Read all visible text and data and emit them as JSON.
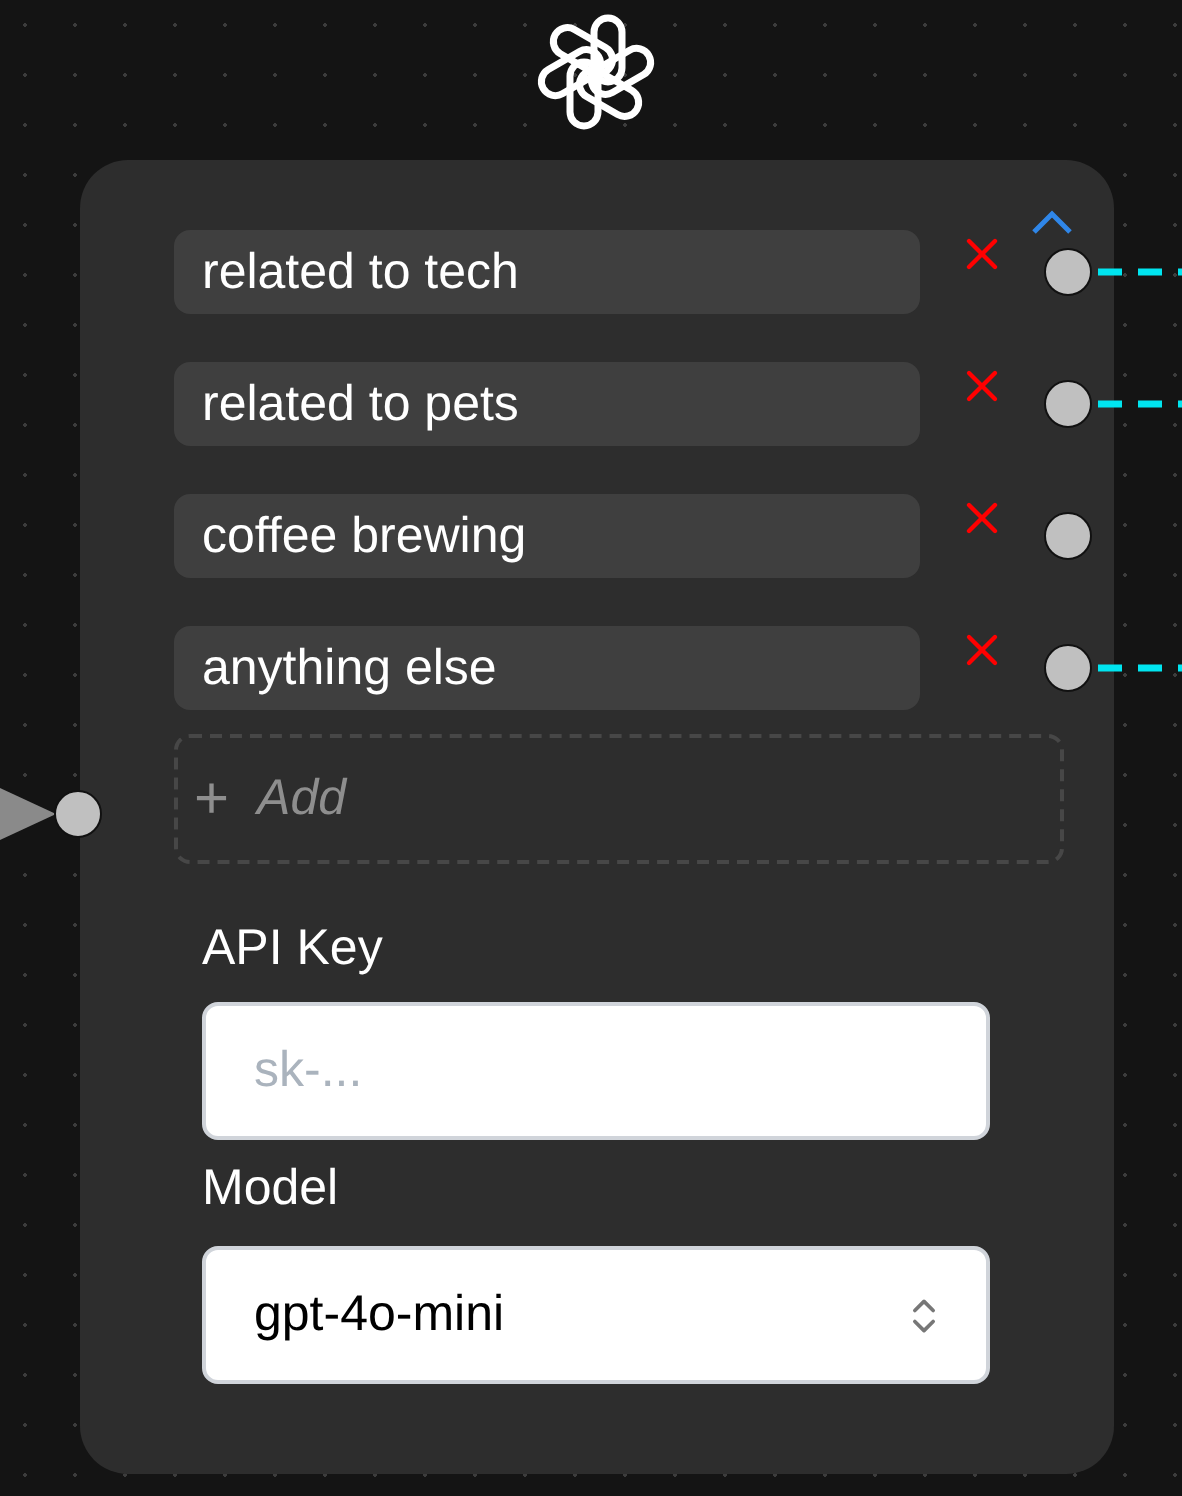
{
  "node": {
    "expanded": true,
    "categories": [
      {
        "label": "related to tech",
        "connected": true
      },
      {
        "label": "related to pets",
        "connected": true
      },
      {
        "label": "coffee brewing",
        "connected": false
      },
      {
        "label": "anything else",
        "connected": true
      }
    ],
    "add_button": {
      "icon": "+",
      "label": "Add"
    },
    "input_connected": true,
    "api_key": {
      "label": "API Key",
      "placeholder": "sk-..."
    },
    "model": {
      "label": "Model",
      "value": "gpt-4o-mini"
    }
  }
}
